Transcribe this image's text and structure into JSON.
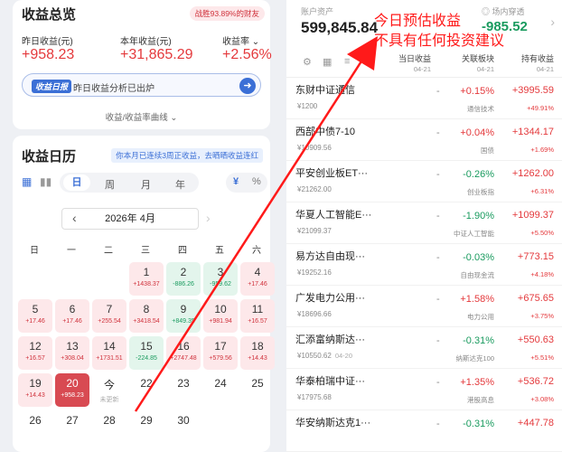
{
  "summary": {
    "title": "收益总览",
    "beat": "战胜93.89%的财友",
    "yesterday_label": "昨日收益(元)",
    "yesterday_value": "+958.23",
    "year_label": "本年收益(元)",
    "year_value": "+31,865.29",
    "rate_label": "收益率 ⌄",
    "rate_value": "+2.56%",
    "ai_tag": "收益日报",
    "ai_text": "昨日收益分析已出炉",
    "curve_link": "收益/收益率曲线 ⌄"
  },
  "calendar": {
    "title": "收益日历",
    "promo": "你本月已连续3周正收益，去晒晒收益连红",
    "tabs": [
      "日",
      "周",
      "月",
      "年"
    ],
    "yen": "¥",
    "pct": "%",
    "month": "2026年 4月",
    "weekdays": [
      "日",
      "一",
      "二",
      "三",
      "四",
      "五",
      "六"
    ],
    "days": [
      {
        "d": "1",
        "v": "+1438.37",
        "t": "pos"
      },
      {
        "d": "2",
        "v": "-886.26",
        "t": "neg"
      },
      {
        "d": "3",
        "v": "-959.62",
        "t": "neg"
      },
      {
        "d": "4",
        "v": "+17.46",
        "t": "pos"
      },
      {
        "d": "5",
        "v": "+17.46",
        "t": "pos"
      },
      {
        "d": "6",
        "v": "+17.46",
        "t": "pos"
      },
      {
        "d": "7",
        "v": "+255.54",
        "t": "pos"
      },
      {
        "d": "8",
        "v": "+3418.54",
        "t": "pos"
      },
      {
        "d": "9",
        "v": "+849.35",
        "t": "neg"
      },
      {
        "d": "10",
        "v": "+981.94",
        "t": "pos"
      },
      {
        "d": "11",
        "v": "+16.57",
        "t": "pos"
      },
      {
        "d": "12",
        "v": "+16.57",
        "t": "pos"
      },
      {
        "d": "13",
        "v": "+308.04",
        "t": "pos"
      },
      {
        "d": "14",
        "v": "+1731.51",
        "t": "pos"
      },
      {
        "d": "15",
        "v": "-224.85",
        "t": "neg"
      },
      {
        "d": "16",
        "v": "+2747.48",
        "t": "pos"
      },
      {
        "d": "17",
        "v": "+579.56",
        "t": "pos"
      },
      {
        "d": "18",
        "v": "+14.43",
        "t": "pos"
      },
      {
        "d": "19",
        "v": "+14.43",
        "t": "pos"
      },
      {
        "d": "20",
        "v": "+958.23",
        "t": "sel"
      },
      {
        "d": "今",
        "v": "未更新",
        "t": "gray"
      },
      {
        "d": "22",
        "v": "",
        "t": "plain"
      },
      {
        "d": "23",
        "v": "",
        "t": "plain"
      },
      {
        "d": "24",
        "v": "",
        "t": "plain"
      },
      {
        "d": "25",
        "v": "",
        "t": "plain"
      },
      {
        "d": "26",
        "v": "",
        "t": "plain"
      },
      {
        "d": "27",
        "v": "",
        "t": "plain"
      },
      {
        "d": "28",
        "v": "",
        "t": "plain"
      },
      {
        "d": "29",
        "v": "",
        "t": "plain"
      },
      {
        "d": "30",
        "v": "",
        "t": "plain"
      }
    ]
  },
  "account": {
    "assets_label": "账户资产",
    "assets_value": "599,845.84",
    "cash_label": "◎ 场内穿透",
    "cash_value": "-985.52",
    "headers": [
      {
        "t": "当日收益",
        "s": "04-21"
      },
      {
        "t": "关联板块",
        "s": "04-21"
      },
      {
        "t": "持有收益",
        "s": "04-21"
      }
    ]
  },
  "funds": [
    {
      "name": "东财中证通信",
      "amount": "¥1200",
      "pct": "+0.15%",
      "sector": "通信技术",
      "gain": "+3995.59",
      "rate": "+49.91%",
      "neg": false
    },
    {
      "name": "西部中债7-10",
      "amount": "¥10909.56",
      "pct": "+0.04%",
      "sector": "国债",
      "gain": "+1344.17",
      "rate": "+1.69%",
      "neg": false
    },
    {
      "name": "平安创业板ET···",
      "amount": "¥21262.00",
      "pct": "-0.26%",
      "sector": "创业板指",
      "gain": "+1262.00",
      "rate": "+6.31%",
      "neg": true
    },
    {
      "name": "华夏人工智能E···",
      "amount": "¥21099.37",
      "pct": "-1.90%",
      "sector": "中证人工智能",
      "gain": "+1099.37",
      "rate": "+5.50%",
      "neg": true
    },
    {
      "name": "易方达自由现···",
      "amount": "¥19252.16",
      "pct": "-0.03%",
      "sector": "自由现金流",
      "gain": "+773.15",
      "rate": "+4.18%",
      "neg": true
    },
    {
      "name": "广发电力公用···",
      "amount": "¥18696.66",
      "pct": "+1.58%",
      "sector": "电力公用",
      "gain": "+675.65",
      "rate": "+3.75%",
      "neg": false
    },
    {
      "name": "汇添富纳斯达···",
      "amount": "¥10550.62",
      "date": "04-20",
      "pct": "-0.31%",
      "sector": "纳斯达克100",
      "gain": "+550.63",
      "rate": "+5.51%",
      "neg": true
    },
    {
      "name": "华泰柏瑞中证···",
      "amount": "¥17975.68",
      "pct": "+1.35%",
      "sector": "港股高息",
      "gain": "+536.72",
      "rate": "+3.08%",
      "neg": false
    },
    {
      "name": "华安纳斯达克1···",
      "amount": "",
      "pct": "-0.31%",
      "sector": "",
      "gain": "+447.78",
      "rate": "",
      "neg": true
    }
  ],
  "annotation": {
    "line1": "今日预估收益",
    "line2": "不具有任何投资建议"
  }
}
